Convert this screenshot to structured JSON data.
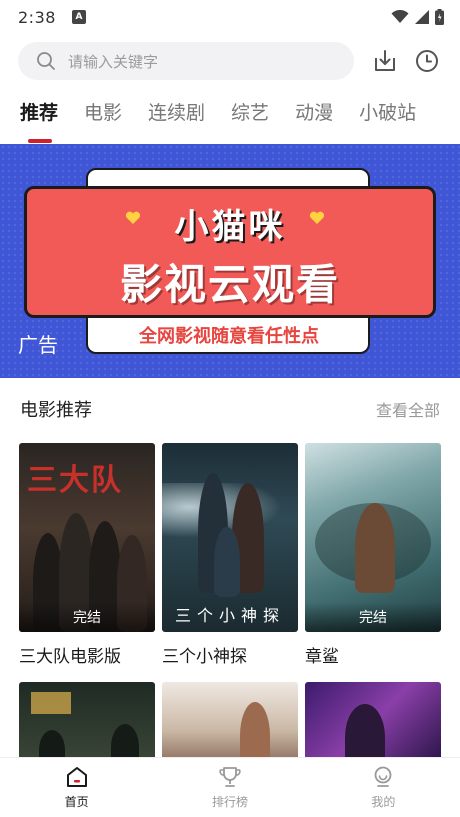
{
  "status_bar": {
    "time": "2:38",
    "notification_icon": "A"
  },
  "search": {
    "placeholder": "请输入关键字",
    "icons": [
      "search-icon",
      "download-icon",
      "history-icon"
    ]
  },
  "tabs": [
    {
      "label": "推荐",
      "active": true
    },
    {
      "label": "电影",
      "active": false
    },
    {
      "label": "连续剧",
      "active": false
    },
    {
      "label": "综艺",
      "active": false
    },
    {
      "label": "动漫",
      "active": false
    },
    {
      "label": "小破站",
      "active": false
    }
  ],
  "banner": {
    "title_line1": "小猫咪",
    "title_line2": "影视云观看",
    "slogan": "全网影视随意看任性点",
    "ad_label": "广告"
  },
  "section": {
    "title": "电影推荐",
    "see_all": "查看全部"
  },
  "movies": [
    {
      "title": "三大队电影版",
      "badge": "完结",
      "poster_text": "三大队"
    },
    {
      "title": "三个小神探",
      "badge": "",
      "poster_text": "三个小神探"
    },
    {
      "title": "章鲨",
      "badge": "完结",
      "poster_text": ""
    },
    {
      "title": "",
      "badge": "",
      "poster_text": ""
    },
    {
      "title": "",
      "badge": "",
      "poster_text": ""
    },
    {
      "title": "",
      "badge": "",
      "poster_text": ""
    }
  ],
  "bottom_nav": [
    {
      "label": "首页",
      "icon": "home-icon",
      "active": true
    },
    {
      "label": "排行榜",
      "icon": "trophy-icon",
      "active": false
    },
    {
      "label": "我的",
      "icon": "profile-icon",
      "active": false
    }
  ],
  "colors": {
    "accent": "#d21f2e",
    "banner_bg": "#3f56d6",
    "banner_card": "#f25a57"
  }
}
